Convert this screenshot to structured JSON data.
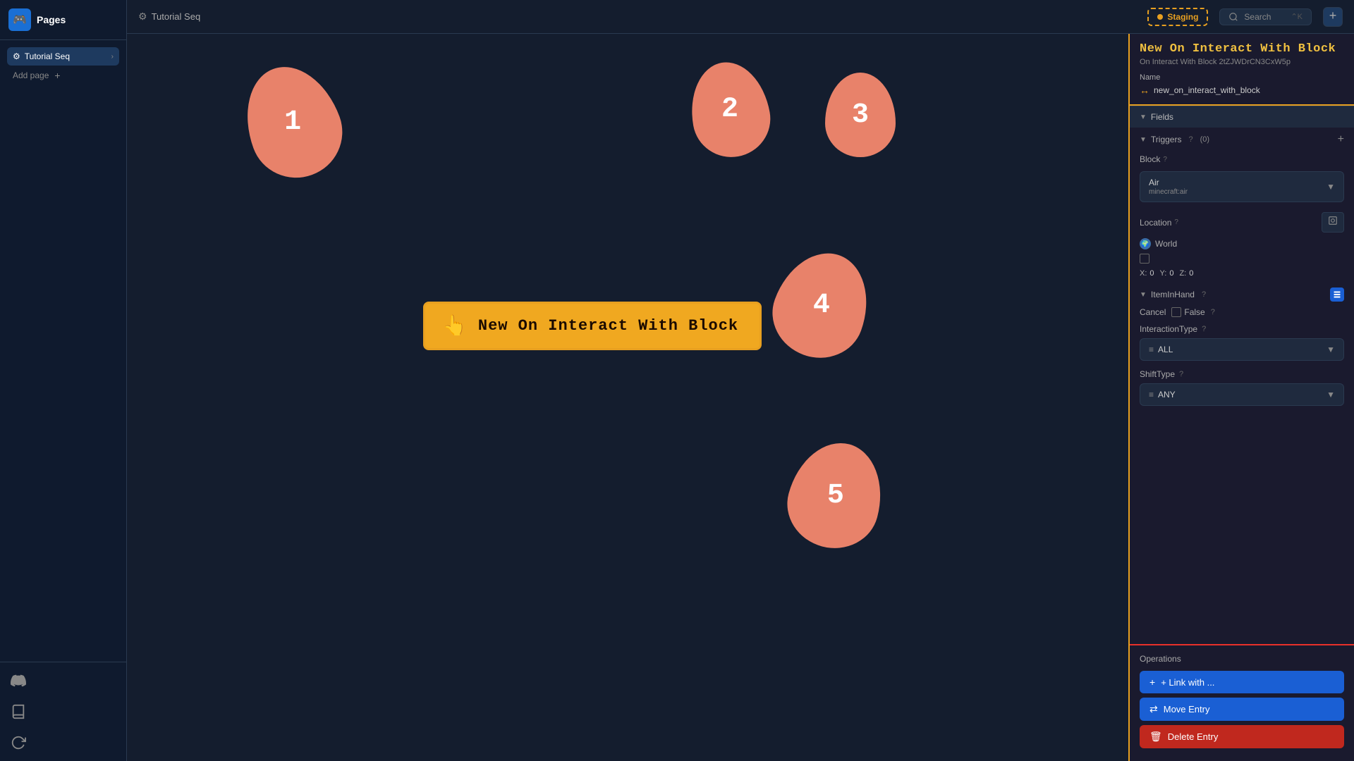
{
  "app": {
    "logo": "🎮",
    "title": "Pages"
  },
  "sidebar": {
    "section": "Pages",
    "items": [
      {
        "label": "Tutorial Seq",
        "active": true,
        "icon": "⚙"
      }
    ],
    "add_page": "Add page",
    "bottom_icons": [
      "discord",
      "book",
      "refresh"
    ]
  },
  "topbar": {
    "breadcrumb": "Tutorial Seq",
    "breadcrumb_icon": "⚙",
    "staging": {
      "label": "Staging"
    },
    "search": {
      "label": "Search",
      "shortcut": "⌃K"
    },
    "add": "+"
  },
  "canvas": {
    "block": {
      "icon": "👆",
      "label": "New On Interact With Block"
    },
    "shapes": [
      {
        "id": 1,
        "num": "1",
        "class": "drop-1"
      },
      {
        "id": 2,
        "num": "2",
        "class": "drop-2"
      },
      {
        "id": 3,
        "num": "3",
        "class": "drop-3"
      },
      {
        "id": 4,
        "num": "4",
        "class": "drop-4"
      },
      {
        "id": 5,
        "num": "5",
        "class": "drop-5"
      }
    ]
  },
  "right_panel": {
    "title": "New On Interact With Block",
    "subtitle": "On Interact With Block  2tZJWDrCN3CxW5p",
    "name_label": "Name",
    "name_icon": "↔",
    "name_value": "new_on_interact_with_block",
    "fields_label": "Fields",
    "triggers_label": "Triggers",
    "triggers_count": "(0)",
    "block_label": "Block",
    "block_value_main": "Air",
    "block_value_sub": "minecraft:air",
    "location_label": "Location",
    "location_world": "World",
    "x_label": "X:",
    "x_value": "0",
    "y_label": "Y:",
    "y_value": "0",
    "z_label": "Z:",
    "z_value": "0",
    "item_in_hand_label": "ItemInHand",
    "cancel_label": "Cancel",
    "cancel_checkbox_label": "False",
    "interaction_type_label": "InteractionType",
    "interaction_type_value": "ALL",
    "shift_type_label": "ShiftType",
    "shift_type_value": "ANY"
  },
  "operations": {
    "title": "Operations",
    "link_btn": "+ Link with ...",
    "move_btn": "Move Entry",
    "delete_btn": "Delete Entry",
    "move_icon": "⇄",
    "delete_icon": "🗑"
  }
}
